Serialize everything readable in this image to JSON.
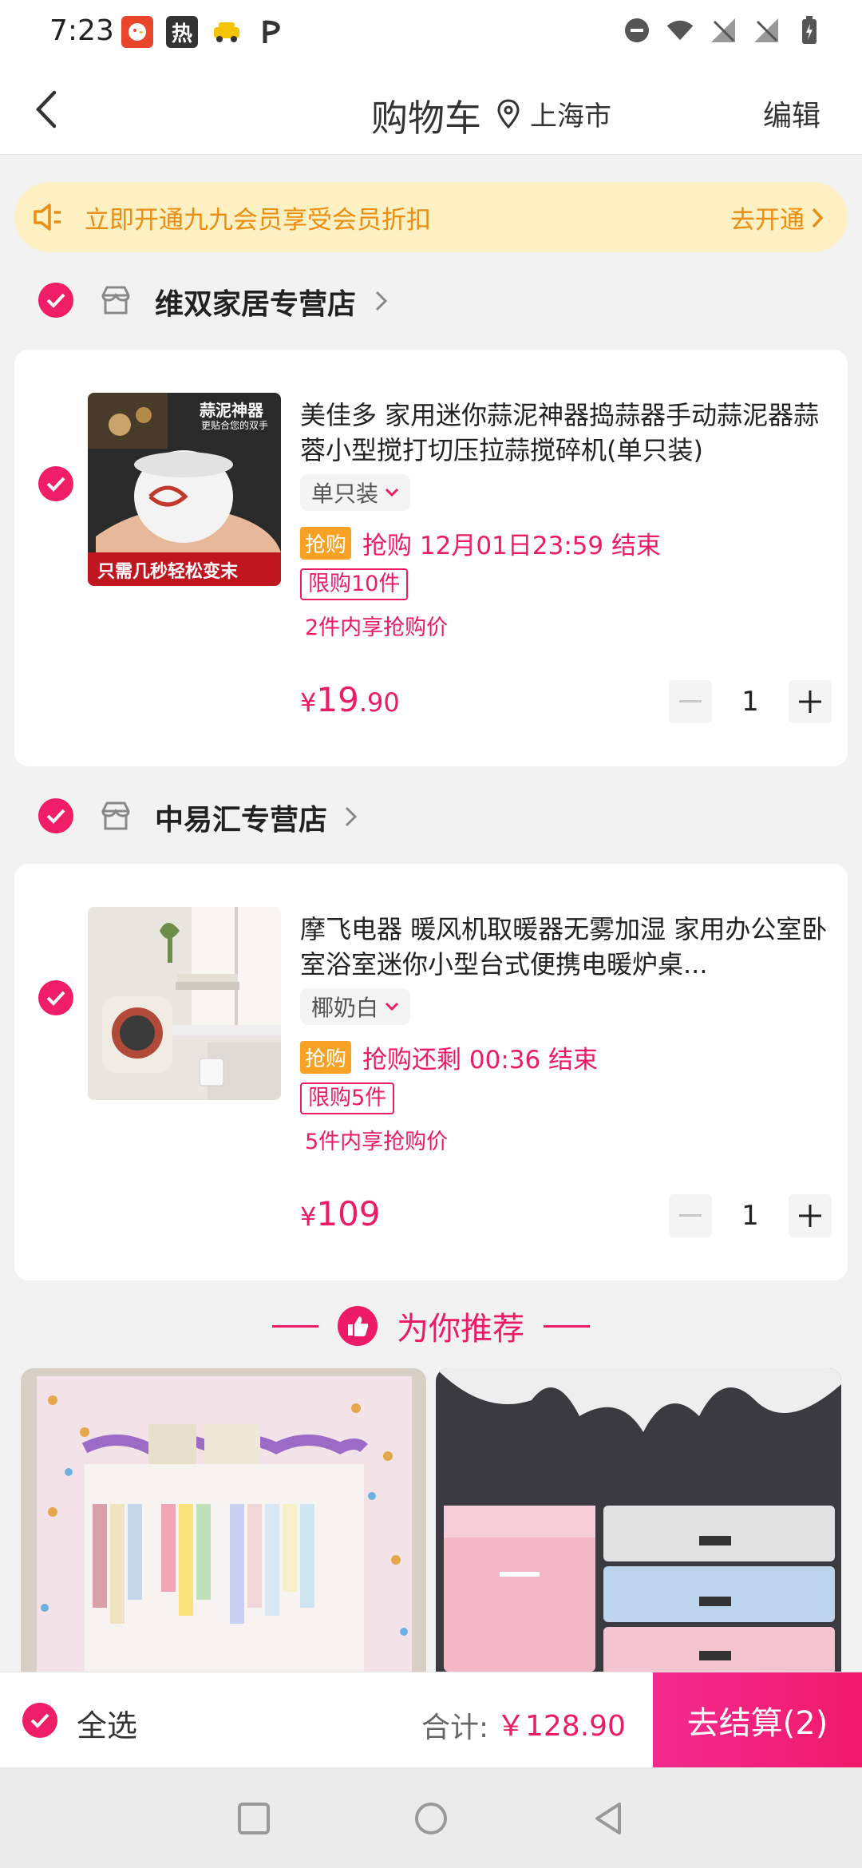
{
  "status_bar": {
    "time": "7:23",
    "left_apps": [
      {
        "name": "app-notification-icon",
        "glyph": "🐥",
        "color": "#e8472b"
      },
      {
        "name": "hot-app-icon",
        "glyph": "热",
        "color": "#333333"
      },
      {
        "name": "taxi-app-icon",
        "glyph": "🚕",
        "color": "#ffffff"
      },
      {
        "name": "p-app-icon",
        "glyph": "P",
        "color": "#ffffff"
      }
    ]
  },
  "header": {
    "title": "购物车",
    "location": "上海市",
    "edit": "编辑"
  },
  "banner": {
    "text": "立即开通九九会员享受会员折扣",
    "cta": "去开通"
  },
  "shops": [
    {
      "name": "维双家居专营店",
      "product": {
        "title": "美佳多 家用迷你蒜泥神器捣蒜器手动蒜泥器蒜蓉小型搅打切压拉蒜搅碎机(单只装)",
        "variant": "单只装",
        "rush_tag": "抢购",
        "rush_text": "抢购  12月01日23:59 结束",
        "limit": "限购10件",
        "discount": "2件内享抢购价",
        "price_currency": "¥",
        "price_int": "19",
        "price_dec": ".90",
        "quantity": "1",
        "image_caption_top": "蒜泥神器",
        "image_caption_sub": "更贴合您的双手",
        "image_caption_bottom": "只需几秒轻松变末"
      }
    },
    {
      "name": "中易汇专营店",
      "product": {
        "title": "摩飞电器 暖风机取暖器无雾加湿 家用办公室卧室浴室迷你小型台式便携电暖炉桌...",
        "variant": "椰奶白",
        "rush_tag": "抢购",
        "rush_text": "抢购还剩 00:36 结束",
        "limit": "限购5件",
        "discount": "5件内享抢购价",
        "price_currency": "¥",
        "price_int": "109",
        "price_dec": "",
        "quantity": "1"
      }
    }
  ],
  "recommend": {
    "title": "为你推荐"
  },
  "bottom": {
    "select_all": "全选",
    "total_label": "合计:",
    "total_value": "￥128.90",
    "checkout": "去结算(2)"
  },
  "colors": {
    "accent": "#ed1b66",
    "banner_text": "#e98d13",
    "banner_bg": "#fdf0c2"
  }
}
